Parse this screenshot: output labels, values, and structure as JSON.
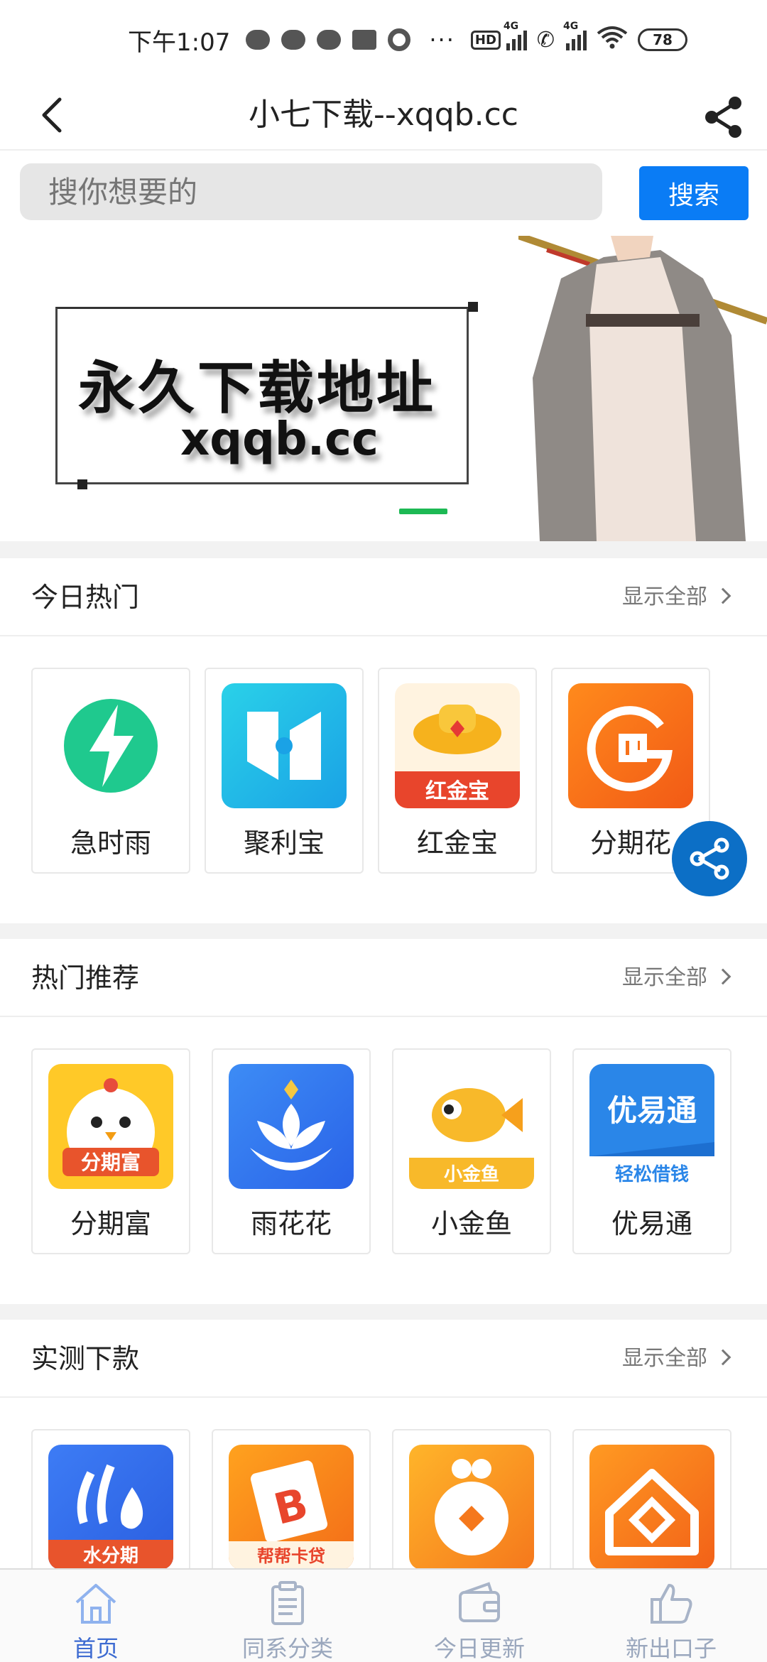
{
  "status_bar": {
    "time": "下午1:07",
    "battery": "78",
    "network_1": "4G",
    "network_2": "4G",
    "hd": "HD",
    "more": "···"
  },
  "header": {
    "title": "小七下载--xqqb.cc"
  },
  "search": {
    "placeholder": "搜你想要的",
    "button_label": "搜索"
  },
  "banner": {
    "headline": "永久下载地址",
    "url": "xqqb.cc"
  },
  "sections": [
    {
      "title": "今日热门",
      "more_label": "显示全部",
      "apps": [
        {
          "name": "急时雨"
        },
        {
          "name": "聚利宝"
        },
        {
          "name": "红金宝"
        },
        {
          "name": "分期花"
        }
      ]
    },
    {
      "title": "热门推荐",
      "more_label": "显示全部",
      "apps": [
        {
          "name": "分期富"
        },
        {
          "name": "雨花花"
        },
        {
          "name": "小金鱼"
        },
        {
          "name": "优易通"
        }
      ]
    },
    {
      "title": "实测下款",
      "more_label": "显示全部",
      "apps": [
        {
          "name": ""
        },
        {
          "name": ""
        },
        {
          "name": ""
        },
        {
          "name": ""
        }
      ]
    }
  ],
  "icon_labels": {
    "hongjinbao": "红金宝",
    "fenqifu": "分期富",
    "xiaojinyu": "小金鱼",
    "youyitong_top": "优易通",
    "youyitong_bottom": "轻松借钱",
    "shuifenqi": "水分期",
    "bangbang": "帮帮卡贷"
  },
  "tabs": [
    {
      "label": "首页",
      "icon": "home-icon",
      "active": true
    },
    {
      "label": "同系分类",
      "icon": "document-icon",
      "active": false
    },
    {
      "label": "今日更新",
      "icon": "wallet-icon",
      "active": false
    },
    {
      "label": "新出口子",
      "icon": "thumbs-up-icon",
      "active": false
    }
  ],
  "colors": {
    "accent": "#0a7cf5",
    "tab_active": "#3d6bd1",
    "tab_inactive": "#9aa7bd",
    "indicator": "#1db954",
    "fab": "#0c6fc6"
  }
}
